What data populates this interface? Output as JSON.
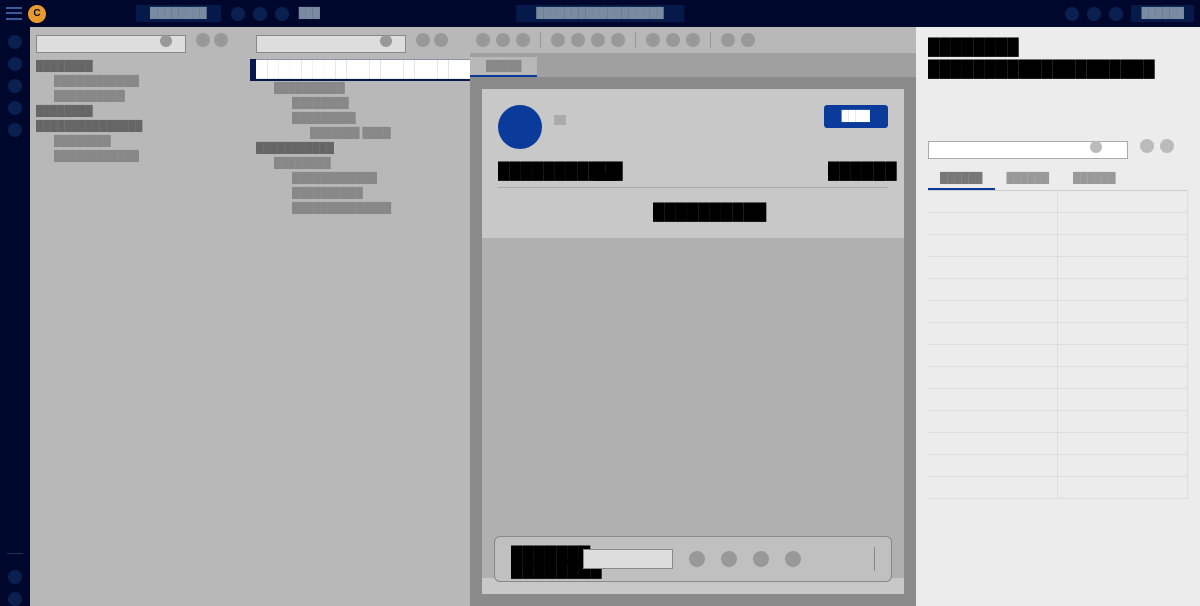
{
  "topbar": {
    "avatar_initial": "C",
    "title": "████████",
    "small_text": "███",
    "center_text": "██████████████████",
    "pill_text": "██████"
  },
  "tree1": {
    "search_placeholder": "",
    "items": [
      {
        "label": "████████",
        "indent": 0,
        "bold": true
      },
      {
        "label": "████████████",
        "indent": 1
      },
      {
        "label": "██████████",
        "indent": 1
      },
      {
        "label": "████████",
        "indent": 0,
        "bold": true
      },
      {
        "label": "███████████████",
        "indent": 0,
        "bold": true
      },
      {
        "label": "████████",
        "indent": 1
      },
      {
        "label": "████████████",
        "indent": 1
      }
    ]
  },
  "tree2": {
    "search_placeholder": "",
    "selected_label": "████████████████████████",
    "items": [
      {
        "label": "██████████",
        "indent": 1
      },
      {
        "label": "████████",
        "indent": 2
      },
      {
        "label": "█████████",
        "indent": 2
      },
      {
        "label": "███████ ████",
        "indent": 3
      },
      {
        "label": "███████████",
        "indent": 0,
        "bold": true
      },
      {
        "label": "████████",
        "indent": 1
      },
      {
        "label": "████████████",
        "indent": 2
      },
      {
        "label": "██████████",
        "indent": 2
      },
      {
        "label": "██████████████",
        "indent": 2
      }
    ]
  },
  "tabs": [
    {
      "label": "█████",
      "active": true
    },
    {
      "label": "",
      "active": false
    }
  ],
  "card": {
    "button_label": "████",
    "row_left": "███████████",
    "row_left_badge": "██",
    "row_right": "█████",
    "row_right_badge": "██",
    "center_text": "██████████",
    "footer_label1": "███████",
    "footer_label2": "████████"
  },
  "right_panel": {
    "title": "████████",
    "subtitle": "████████████████████",
    "search_placeholder": "",
    "tabs": [
      {
        "label": "██████",
        "active": true
      },
      {
        "label": "██████",
        "active": false
      },
      {
        "label": "██████",
        "active": false
      }
    ],
    "rows": 14
  }
}
